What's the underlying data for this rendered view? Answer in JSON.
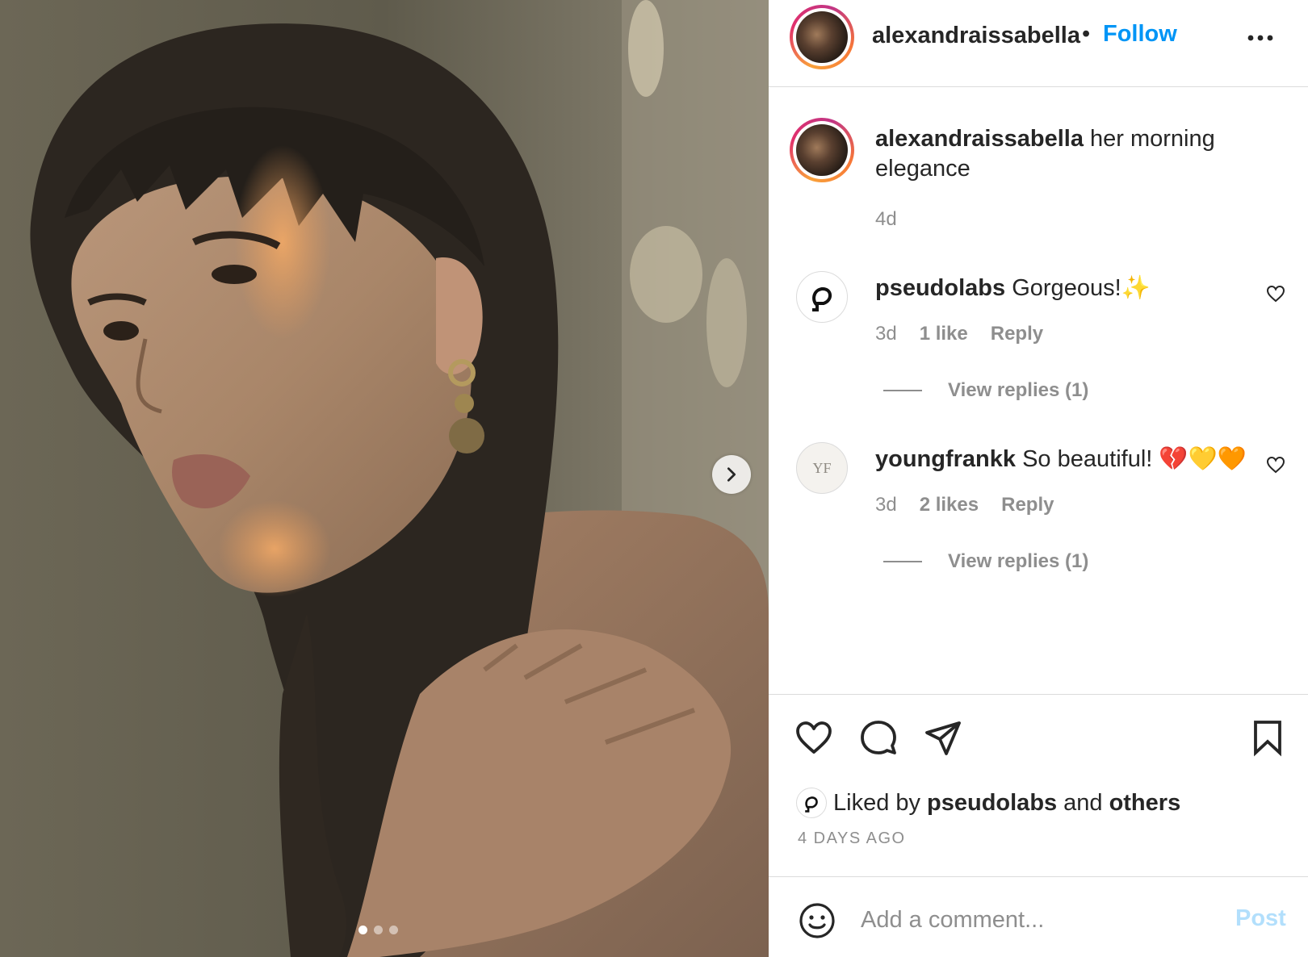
{
  "post": {
    "username": "alexandraissabella",
    "follow_label": "Follow",
    "caption": "her morning elegance",
    "caption_time": "4d",
    "photo_count": 3,
    "active_photo": 1
  },
  "comments": [
    {
      "username": "pseudolabs",
      "text": "Gorgeous!✨",
      "time": "3d",
      "likes": "1 like",
      "reply_label": "Reply",
      "view_replies": "View replies (1)"
    },
    {
      "username": "youngfrankk",
      "text": "So beautiful! 💔💛🧡",
      "time": "3d",
      "likes": "2 likes",
      "reply_label": "Reply",
      "view_replies": "View replies (1)",
      "avatar_initials": "YF"
    }
  ],
  "likes": {
    "prefix": "Liked by",
    "user": "pseudolabs",
    "middle": "and",
    "suffix": "others"
  },
  "timestamp": "4 DAYS AGO",
  "comment_box": {
    "placeholder": "Add a comment...",
    "post_label": "Post"
  },
  "colors": {
    "accent": "#0095f6",
    "post_disabled": "#b2dffc",
    "muted": "#8e8e8e"
  }
}
